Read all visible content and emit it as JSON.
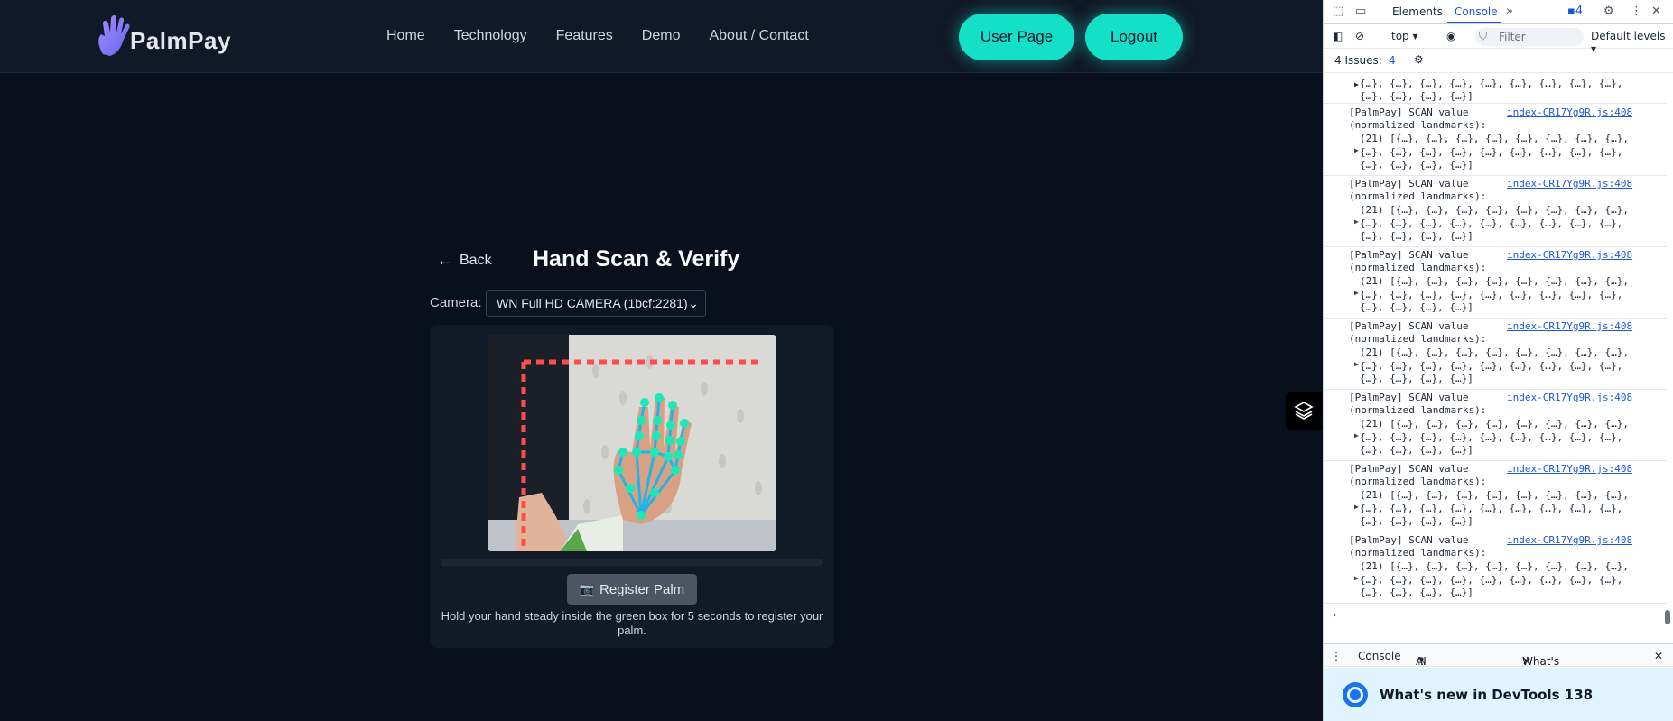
{
  "brand": {
    "name": "PalmPay"
  },
  "nav": {
    "items": [
      "Home",
      "Technology",
      "Features",
      "Demo",
      "About / Contact"
    ]
  },
  "header_buttons": {
    "user_page": "User Page",
    "logout": "Logout"
  },
  "scan": {
    "back": "Back",
    "title": "Hand Scan & Verify",
    "camera_label": "Camera:",
    "camera_value": "WN Full HD CAMERA (1bcf:2281)",
    "register_button": "Register Palm",
    "hint": "Hold your hand steady inside the green box for 5 seconds to register your palm.",
    "progress": 0
  },
  "devtools": {
    "tabs": {
      "elements": "Elements",
      "console": "Console",
      "issue_badge": "4"
    },
    "toolbar": {
      "context": "top",
      "filter_placeholder": "Filter",
      "levels": "Default levels"
    },
    "issues": {
      "label": "4 Issues:",
      "count": "4"
    },
    "top_partial": {
      "line1": "{…}, {…}, {…}, {…}, {…}, {…}, {…}, {…}, {…},",
      "line2": "{…}, {…}, {…}, {…}]"
    },
    "log_entries": [
      {
        "msg": "[PalmPay] SCAN value",
        "source": "index-CR17Yg9R.js:408",
        "sub": "(normalized landmarks):",
        "l3": "(21) [{…}, {…}, {…}, {…}, {…}, {…}, {…}, {…},",
        "l4": "{…}, {…}, {…}, {…}, {…}, {…}, {…}, {…}, {…},",
        "l5": "{…}, {…}, {…}, {…}]"
      },
      {
        "msg": "[PalmPay] SCAN value",
        "source": "index-CR17Yg9R.js:408",
        "sub": "(normalized landmarks):",
        "l3": "(21) [{…}, {…}, {…}, {…}, {…}, {…}, {…}, {…},",
        "l4": "{…}, {…}, {…}, {…}, {…}, {…}, {…}, {…}, {…},",
        "l5": "{…}, {…}, {…}, {…}]"
      },
      {
        "msg": "[PalmPay] SCAN value",
        "source": "index-CR17Yg9R.js:408",
        "sub": "(normalized landmarks):",
        "l3": "(21) [{…}, {…}, {…}, {…}, {…}, {…}, {…}, {…},",
        "l4": "{…}, {…}, {…}, {…}, {…}, {…}, {…}, {…}, {…},",
        "l5": "{…}, {…}, {…}, {…}]"
      },
      {
        "msg": "[PalmPay] SCAN value",
        "source": "index-CR17Yg9R.js:408",
        "sub": "(normalized landmarks):",
        "l3": "(21) [{…}, {…}, {…}, {…}, {…}, {…}, {…}, {…},",
        "l4": "{…}, {…}, {…}, {…}, {…}, {…}, {…}, {…}, {…},",
        "l5": "{…}, {…}, {…}, {…}]"
      },
      {
        "msg": "[PalmPay] SCAN value",
        "source": "index-CR17Yg9R.js:408",
        "sub": "(normalized landmarks):",
        "l3": "(21) [{…}, {…}, {…}, {…}, {…}, {…}, {…}, {…},",
        "l4": "{…}, {…}, {…}, {…}, {…}, {…}, {…}, {…}, {…},",
        "l5": "{…}, {…}, {…}, {…}]"
      },
      {
        "msg": "[PalmPay] SCAN value",
        "source": "index-CR17Yg9R.js:408",
        "sub": "(normalized landmarks):",
        "l3": "(21) [{…}, {…}, {…}, {…}, {…}, {…}, {…}, {…},",
        "l4": "{…}, {…}, {…}, {…}, {…}, {…}, {…}, {…}, {…},",
        "l5": "{…}, {…}, {…}, {…}]"
      },
      {
        "msg": "[PalmPay] SCAN value",
        "source": "index-CR17Yg9R.js:408",
        "sub": "(normalized landmarks):",
        "l3": "(21) [{…}, {…}, {…}, {…}, {…}, {…}, {…}, {…},",
        "l4": "{…}, {…}, {…}, {…}, {…}, {…}, {…}, {…}, {…},",
        "l5": "{…}, {…}, {…}, {…}]"
      }
    ],
    "drawer": {
      "console": "Console",
      "ai": "AI assistance",
      "whats_new": "What's new"
    },
    "banner": "What's new in DevTools 138"
  },
  "colors": {
    "accent": "#14e0c8",
    "landmark": "#1de9b6",
    "guide_box": "#ff4d4d"
  }
}
